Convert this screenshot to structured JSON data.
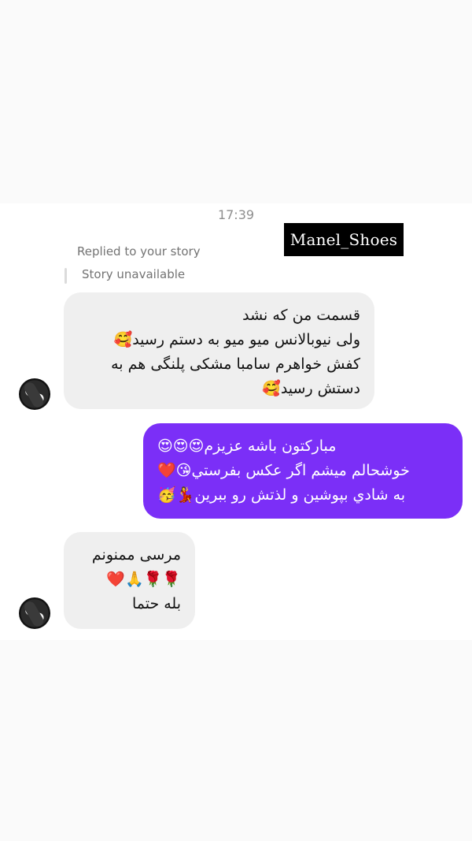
{
  "chat": {
    "timestamp": "17:39",
    "brand_tag": "Manel_Shoes",
    "reply_context": {
      "note": "Replied to your story",
      "story_status": "Story unavailable"
    },
    "messages": [
      {
        "direction": "incoming",
        "lines": [
          "قسمت من که نشد",
          "ولی نیوبالانس میو میو به دستم رسید🥰",
          "کفش خواهرم سامبا مشکی پلنگی هم به",
          "دستش رسید🥰"
        ]
      },
      {
        "direction": "outgoing",
        "lines": [
          "مبارکتون باشه عزیزم😍😍😍",
          "خوشحالم میشم اگر عکس بفرستي😘❤️",
          "به شادي بپوشين و لذتش رو ببرين💃🥳"
        ]
      },
      {
        "direction": "incoming",
        "lines": [
          "مرسی ممنونم",
          "❤️🙏🌹🌹",
          "بله حتما"
        ]
      }
    ]
  },
  "colors": {
    "outgoing_bubble": "#7b2ff7",
    "incoming_bubble": "#efefef",
    "meta_text": "#8e8e8e"
  }
}
